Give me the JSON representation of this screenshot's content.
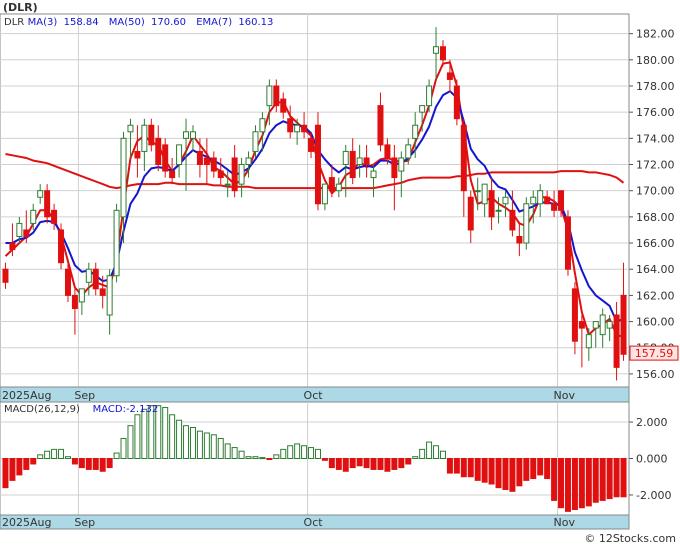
{
  "header": {
    "symbol": "(DLR)"
  },
  "watermark": "© 12Stocks.com",
  "colors": {
    "up": "#2e7d32",
    "down": "#e01010",
    "ma3": "#e01010",
    "ma50": "#e01010",
    "ema7": "#1515d0",
    "axis_band": "#add8e6",
    "price_label_bg": "#ffe4e1",
    "macd_pos_fill": "#ffffff",
    "macd_neg_fill": "#e01010"
  },
  "chart_data": [
    {
      "type": "candlestick",
      "legend": {
        "items": [
          {
            "label": "DLR",
            "color": "#333333"
          },
          {
            "label": "MA(3)",
            "value": "158.84",
            "color": "#1515d0"
          },
          {
            "label": "MA(50)",
            "value": "170.60",
            "color": "#1515d0"
          },
          {
            "label": "EMA(7)",
            "value": "160.13",
            "color": "#1515d0"
          }
        ]
      },
      "last_price": "157.59",
      "ylim": [
        155.0,
        183.5
      ],
      "y_ticks": [
        "156.00",
        "158.00",
        "160.00",
        "162.00",
        "164.00",
        "166.00",
        "168.00",
        "170.00",
        "172.00",
        "174.00",
        "176.00",
        "178.00",
        "180.00",
        "182.00"
      ],
      "x_labels": [
        {
          "label": "2025Aug",
          "index": 0
        },
        {
          "label": "Sep",
          "index": 11
        },
        {
          "label": "Oct",
          "index": 44
        },
        {
          "label": "Nov",
          "index": 80
        }
      ],
      "candles": [
        [
          164.0,
          164.5,
          162.5,
          163.0
        ],
        [
          166.0,
          167.5,
          165.0,
          165.5
        ],
        [
          166.5,
          168.0,
          166.0,
          167.5
        ],
        [
          167.0,
          168.5,
          166.0,
          166.5
        ],
        [
          167.5,
          169.0,
          167.0,
          168.5
        ],
        [
          169.5,
          170.5,
          169.0,
          170.0
        ],
        [
          170.0,
          170.5,
          167.5,
          168.0
        ],
        [
          168.5,
          169.0,
          167.0,
          167.5
        ],
        [
          167.0,
          167.5,
          164.0,
          164.5
        ],
        [
          164.0,
          164.5,
          161.5,
          162.0
        ],
        [
          162.0,
          162.5,
          159.0,
          161.0
        ],
        [
          161.5,
          162.5,
          160.5,
          162.5
        ],
        [
          163.0,
          164.5,
          162.0,
          164.0
        ],
        [
          164.0,
          164.5,
          162.0,
          162.5
        ],
        [
          162.5,
          163.5,
          161.0,
          162.0
        ],
        [
          160.5,
          164.0,
          159.0,
          163.5
        ],
        [
          163.5,
          169.0,
          163.0,
          168.5
        ],
        [
          168.0,
          174.5,
          166.0,
          174.0
        ],
        [
          174.5,
          175.5,
          172.5,
          175.0
        ],
        [
          173.0,
          175.0,
          171.0,
          172.5
        ],
        [
          173.0,
          175.5,
          171.5,
          175.0
        ],
        [
          175.0,
          175.5,
          173.0,
          173.5
        ],
        [
          174.0,
          175.0,
          171.5,
          172.0
        ],
        [
          173.5,
          174.0,
          171.0,
          171.5
        ],
        [
          171.5,
          172.5,
          170.5,
          171.0
        ],
        [
          172.0,
          173.5,
          171.0,
          173.5
        ],
        [
          174.0,
          175.5,
          170.0,
          174.5
        ],
        [
          174.0,
          175.0,
          173.0,
          174.5
        ],
        [
          173.0,
          174.0,
          171.0,
          172.0
        ],
        [
          172.5,
          174.0,
          170.5,
          172.0
        ],
        [
          172.5,
          173.0,
          171.0,
          171.5
        ],
        [
          171.5,
          172.5,
          170.5,
          171.0
        ],
        [
          170.5,
          171.5,
          169.5,
          170.5
        ],
        [
          172.5,
          173.5,
          169.5,
          170.0
        ],
        [
          170.5,
          172.5,
          169.5,
          172.0
        ],
        [
          172.0,
          173.0,
          171.0,
          172.5
        ],
        [
          173.0,
          175.0,
          172.5,
          174.5
        ],
        [
          174.5,
          176.0,
          173.0,
          175.5
        ],
        [
          176.5,
          178.5,
          175.0,
          178.0
        ],
        [
          178.0,
          178.5,
          176.0,
          176.5
        ],
        [
          177.0,
          177.5,
          175.5,
          176.0
        ],
        [
          175.5,
          176.5,
          174.0,
          174.5
        ],
        [
          174.5,
          175.5,
          173.5,
          175.0
        ],
        [
          175.0,
          176.0,
          174.0,
          174.5
        ],
        [
          174.0,
          174.5,
          172.5,
          173.0
        ],
        [
          175.0,
          176.0,
          168.5,
          169.0
        ],
        [
          169.0,
          170.5,
          168.5,
          170.5
        ],
        [
          171.0,
          172.0,
          169.5,
          170.0
        ],
        [
          170.0,
          171.0,
          169.5,
          170.5
        ],
        [
          172.0,
          173.5,
          169.5,
          173.0
        ],
        [
          173.0,
          174.0,
          170.5,
          171.0
        ],
        [
          172.0,
          173.5,
          171.0,
          172.5
        ],
        [
          172.5,
          173.5,
          171.0,
          172.0
        ],
        [
          171.0,
          172.0,
          169.5,
          171.5
        ],
        [
          176.5,
          177.5,
          173.0,
          173.5
        ],
        [
          173.5,
          174.0,
          172.0,
          172.5
        ],
        [
          172.5,
          173.5,
          168.5,
          171.0
        ],
        [
          171.5,
          173.0,
          169.5,
          172.5
        ],
        [
          172.5,
          174.0,
          172.0,
          173.5
        ],
        [
          174.0,
          176.0,
          172.5,
          175.0
        ],
        [
          176.0,
          176.5,
          174.5,
          176.5
        ],
        [
          176.5,
          178.5,
          176.0,
          178.0
        ],
        [
          180.5,
          182.5,
          178.5,
          181.0
        ],
        [
          181.0,
          181.5,
          179.5,
          180.0
        ],
        [
          179.0,
          180.0,
          177.5,
          178.5
        ],
        [
          178.0,
          178.5,
          175.0,
          175.5
        ],
        [
          175.0,
          175.5,
          168.0,
          170.0
        ],
        [
          169.5,
          170.0,
          166.0,
          167.0
        ],
        [
          170.0,
          171.0,
          168.5,
          170.0
        ],
        [
          169.0,
          170.5,
          168.0,
          170.5
        ],
        [
          170.0,
          171.0,
          167.0,
          168.0
        ],
        [
          168.5,
          169.5,
          167.5,
          168.5
        ],
        [
          169.0,
          170.0,
          168.0,
          169.5
        ],
        [
          168.5,
          170.0,
          166.5,
          167.0
        ],
        [
          166.5,
          167.5,
          165.0,
          166.0
        ],
        [
          166.0,
          169.5,
          165.5,
          169.0
        ],
        [
          169.0,
          170.0,
          167.5,
          169.5
        ],
        [
          169.0,
          170.5,
          168.0,
          170.0
        ],
        [
          169.5,
          170.0,
          169.0,
          169.0
        ],
        [
          169.0,
          170.0,
          168.0,
          168.5
        ],
        [
          170.0,
          170.0,
          168.0,
          168.5
        ],
        [
          168.0,
          168.5,
          163.5,
          164.0
        ],
        [
          162.5,
          163.0,
          157.5,
          158.5
        ],
        [
          160.0,
          160.5,
          156.5,
          159.5
        ],
        [
          158.0,
          159.5,
          157.0,
          159.0
        ],
        [
          159.5,
          160.0,
          158.0,
          160.0
        ],
        [
          159.0,
          161.0,
          158.0,
          160.5
        ],
        [
          159.5,
          160.5,
          158.5,
          160.0
        ],
        [
          160.5,
          161.5,
          155.5,
          156.5
        ],
        [
          162.0,
          164.5,
          157.0,
          157.5
        ]
      ],
      "ema7": [
        166.0,
        166.0,
        166.3,
        166.4,
        166.8,
        167.6,
        167.7,
        167.6,
        166.8,
        165.6,
        164.3,
        163.8,
        163.9,
        163.5,
        163.1,
        163.2,
        164.5,
        166.9,
        169.0,
        169.8,
        171.1,
        171.7,
        171.8,
        171.7,
        171.5,
        172.0,
        172.6,
        173.1,
        172.8,
        172.6,
        172.3,
        172.0,
        171.6,
        171.2,
        171.4,
        171.7,
        172.4,
        173.2,
        174.4,
        175.0,
        175.3,
        175.1,
        175.0,
        174.9,
        174.4,
        173.1,
        172.4,
        171.8,
        171.4,
        171.8,
        171.6,
        171.8,
        171.9,
        171.8,
        172.3,
        172.3,
        172.0,
        172.1,
        172.5,
        173.1,
        173.9,
        174.9,
        176.4,
        177.3,
        177.6,
        177.1,
        175.3,
        173.2,
        172.4,
        171.9,
        170.9,
        170.3,
        170.1,
        169.3,
        168.4,
        168.6,
        168.8,
        169.1,
        169.1,
        169.0,
        168.9,
        167.6,
        165.3,
        163.9,
        162.7,
        162.0,
        161.6,
        161.2,
        160.0,
        160.2
      ],
      "ma3": [
        165.0,
        165.5,
        166.0,
        166.5,
        167.5,
        168.5,
        168.5,
        167.8,
        166.6,
        164.6,
        162.6,
        162.0,
        162.6,
        163.0,
        162.8,
        162.6,
        164.7,
        168.7,
        172.5,
        173.8,
        174.2,
        173.7,
        173.5,
        172.3,
        171.5,
        172.0,
        173.0,
        174.2,
        173.5,
        172.8,
        171.8,
        171.5,
        171.0,
        170.5,
        170.8,
        171.6,
        173.1,
        174.2,
        176.0,
        176.7,
        176.8,
        175.7,
        175.2,
        174.7,
        174.2,
        172.2,
        170.8,
        169.8,
        170.3,
        171.2,
        171.5,
        172.2,
        171.8,
        172.0,
        172.4,
        172.5,
        172.3,
        172.2,
        172.3,
        173.7,
        175.0,
        176.5,
        178.5,
        179.7,
        179.8,
        178.0,
        174.7,
        170.8,
        169.0,
        169.2,
        169.5,
        169.0,
        168.7,
        168.3,
        167.5,
        167.3,
        168.2,
        169.5,
        169.5,
        169.2,
        168.7,
        167.0,
        163.7,
        160.7,
        159.0,
        159.5,
        159.8,
        160.2,
        159.0,
        158.8
      ],
      "ma50": [
        172.8,
        172.7,
        172.6,
        172.5,
        172.3,
        172.2,
        172.1,
        171.9,
        171.7,
        171.5,
        171.3,
        171.1,
        170.9,
        170.7,
        170.5,
        170.3,
        170.2,
        170.3,
        170.4,
        170.5,
        170.5,
        170.5,
        170.5,
        170.6,
        170.6,
        170.5,
        170.5,
        170.5,
        170.5,
        170.5,
        170.4,
        170.4,
        170.3,
        170.3,
        170.3,
        170.3,
        170.2,
        170.2,
        170.2,
        170.2,
        170.2,
        170.2,
        170.2,
        170.2,
        170.2,
        170.2,
        170.2,
        170.2,
        170.2,
        170.2,
        170.2,
        170.2,
        170.2,
        170.2,
        170.3,
        170.4,
        170.5,
        170.6,
        170.8,
        170.9,
        171.0,
        171.0,
        171.0,
        171.0,
        171.0,
        171.1,
        171.1,
        171.2,
        171.3,
        171.3,
        171.4,
        171.4,
        171.4,
        171.4,
        171.4,
        171.4,
        171.4,
        171.4,
        171.4,
        171.4,
        171.5,
        171.5,
        171.5,
        171.5,
        171.4,
        171.4,
        171.3,
        171.2,
        171.0,
        170.6
      ]
    },
    {
      "type": "histogram",
      "legend": {
        "items": [
          {
            "label": "MACD(26,12,9)",
            "color": "#333333"
          },
          {
            "label": "MACD:-2.132",
            "color": "#1515d0"
          }
        ]
      },
      "ylim": [
        -3.1,
        3.1
      ],
      "y_ticks": [
        "2.000",
        "0.000",
        "-2.000"
      ],
      "x_labels": [
        {
          "label": "2025Aug",
          "index": 0
        },
        {
          "label": "Sep",
          "index": 11
        },
        {
          "label": "Oct",
          "index": 44
        },
        {
          "label": "Nov",
          "index": 80
        }
      ],
      "values": [
        -1.6,
        -1.2,
        -0.9,
        -0.6,
        -0.3,
        0.2,
        0.4,
        0.5,
        0.5,
        0.1,
        -0.3,
        -0.5,
        -0.6,
        -0.6,
        -0.7,
        -0.5,
        0.3,
        1.1,
        1.8,
        2.4,
        2.7,
        2.9,
        2.9,
        2.8,
        2.4,
        2.1,
        1.8,
        1.7,
        1.5,
        1.4,
        1.3,
        1.1,
        0.8,
        0.6,
        0.4,
        0.1,
        0.1,
        0.05,
        -0.05,
        0.2,
        0.5,
        0.7,
        0.8,
        0.7,
        0.6,
        0.5,
        -0.1,
        -0.5,
        -0.6,
        -0.7,
        -0.5,
        -0.4,
        -0.5,
        -0.6,
        -0.6,
        -0.7,
        -0.6,
        -0.5,
        -0.3,
        0.1,
        0.5,
        0.9,
        0.7,
        0.4,
        -0.8,
        -0.8,
        -1.0,
        -1.0,
        -1.2,
        -1.3,
        -1.4,
        -1.6,
        -1.7,
        -1.8,
        -1.5,
        -1.2,
        -1.1,
        -0.9,
        -1.1,
        -2.3,
        -2.7,
        -2.9,
        -2.8,
        -2.7,
        -2.6,
        -2.4,
        -2.3,
        -2.2,
        -2.1,
        -2.1
      ]
    }
  ]
}
